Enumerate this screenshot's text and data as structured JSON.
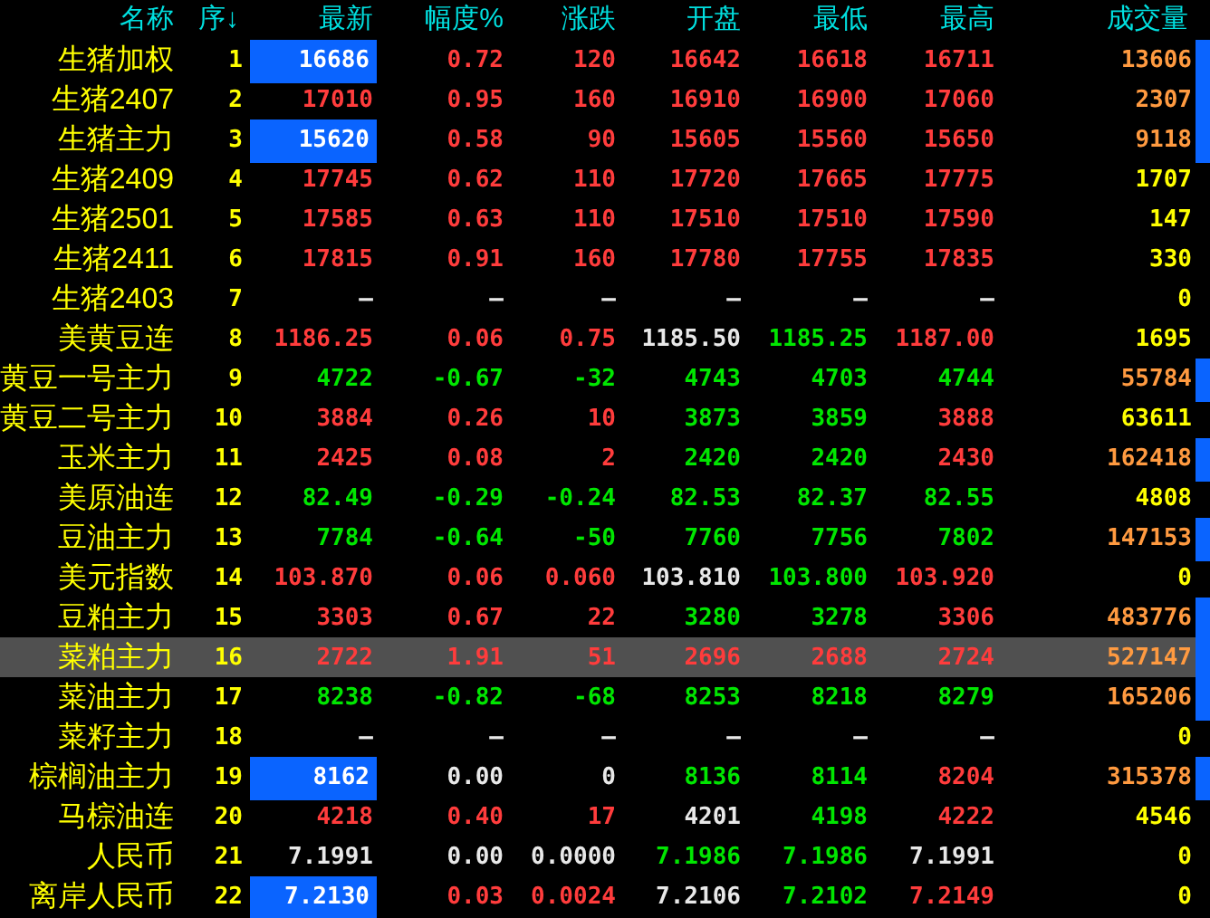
{
  "columns": [
    "名称",
    "序↓",
    "最新",
    "幅度%",
    "涨跌",
    "开盘",
    "最低",
    "最高",
    "成交量"
  ],
  "rows": [
    {
      "name": "生猪加权",
      "seq": "1",
      "selected": false,
      "latest_highlight": true,
      "volume_flag": true,
      "cells": [
        {
          "text": "16686"
        },
        {
          "text": "0.72",
          "kind": "up"
        },
        {
          "text": "120",
          "kind": "up"
        },
        {
          "text": "16642",
          "kind": "up"
        },
        {
          "text": "16618",
          "kind": "up"
        },
        {
          "text": "16711",
          "kind": "up"
        }
      ],
      "volume": {
        "text": "13606",
        "kind": "heavy"
      }
    },
    {
      "name": "生猪2407",
      "seq": "2",
      "selected": false,
      "latest_highlight": false,
      "volume_flag": true,
      "cells": [
        {
          "text": "17010",
          "kind": "up"
        },
        {
          "text": "0.95",
          "kind": "up"
        },
        {
          "text": "160",
          "kind": "up"
        },
        {
          "text": "16910",
          "kind": "up"
        },
        {
          "text": "16900",
          "kind": "up"
        },
        {
          "text": "17060",
          "kind": "up"
        }
      ],
      "volume": {
        "text": "2307",
        "kind": "heavy"
      }
    },
    {
      "name": "生猪主力",
      "seq": "3",
      "selected": false,
      "latest_highlight": true,
      "volume_flag": true,
      "cells": [
        {
          "text": "15620"
        },
        {
          "text": "0.58",
          "kind": "up"
        },
        {
          "text": "90",
          "kind": "up"
        },
        {
          "text": "15605",
          "kind": "up"
        },
        {
          "text": "15560",
          "kind": "up"
        },
        {
          "text": "15650",
          "kind": "up"
        }
      ],
      "volume": {
        "text": "9118",
        "kind": "heavy"
      }
    },
    {
      "name": "生猪2409",
      "seq": "4",
      "selected": false,
      "latest_highlight": false,
      "volume_flag": false,
      "cells": [
        {
          "text": "17745",
          "kind": "up"
        },
        {
          "text": "0.62",
          "kind": "up"
        },
        {
          "text": "110",
          "kind": "up"
        },
        {
          "text": "17720",
          "kind": "up"
        },
        {
          "text": "17665",
          "kind": "up"
        },
        {
          "text": "17775",
          "kind": "up"
        }
      ],
      "volume": {
        "text": "1707",
        "kind": "light"
      }
    },
    {
      "name": "生猪2501",
      "seq": "5",
      "selected": false,
      "latest_highlight": false,
      "volume_flag": false,
      "cells": [
        {
          "text": "17585",
          "kind": "up"
        },
        {
          "text": "0.63",
          "kind": "up"
        },
        {
          "text": "110",
          "kind": "up"
        },
        {
          "text": "17510",
          "kind": "up"
        },
        {
          "text": "17510",
          "kind": "up"
        },
        {
          "text": "17590",
          "kind": "up"
        }
      ],
      "volume": {
        "text": "147",
        "kind": "light"
      }
    },
    {
      "name": "生猪2411",
      "seq": "6",
      "selected": false,
      "latest_highlight": false,
      "volume_flag": false,
      "cells": [
        {
          "text": "17815",
          "kind": "up"
        },
        {
          "text": "0.91",
          "kind": "up"
        },
        {
          "text": "160",
          "kind": "up"
        },
        {
          "text": "17780",
          "kind": "up"
        },
        {
          "text": "17755",
          "kind": "up"
        },
        {
          "text": "17835",
          "kind": "up"
        }
      ],
      "volume": {
        "text": "330",
        "kind": "light"
      }
    },
    {
      "name": "生猪2403",
      "seq": "7",
      "selected": false,
      "latest_highlight": false,
      "volume_flag": false,
      "cells": [
        {
          "text": "—",
          "kind": "flat"
        },
        {
          "text": "—",
          "kind": "flat"
        },
        {
          "text": "—",
          "kind": "flat"
        },
        {
          "text": "—",
          "kind": "flat"
        },
        {
          "text": "—",
          "kind": "flat"
        },
        {
          "text": "—",
          "kind": "flat"
        }
      ],
      "volume": {
        "text": "0",
        "kind": "light"
      }
    },
    {
      "name": "美黄豆连",
      "seq": "8",
      "selected": false,
      "latest_highlight": false,
      "volume_flag": false,
      "cells": [
        {
          "text": "1186.25",
          "kind": "up"
        },
        {
          "text": "0.06",
          "kind": "up"
        },
        {
          "text": "0.75",
          "kind": "up"
        },
        {
          "text": "1185.50",
          "kind": "flat"
        },
        {
          "text": "1185.25",
          "kind": "down"
        },
        {
          "text": "1187.00",
          "kind": "up"
        }
      ],
      "volume": {
        "text": "1695",
        "kind": "light"
      }
    },
    {
      "name": "黄豆一号主力",
      "seq": "9",
      "selected": false,
      "latest_highlight": false,
      "volume_flag": true,
      "cells": [
        {
          "text": "4722",
          "kind": "down"
        },
        {
          "text": "-0.67",
          "kind": "down"
        },
        {
          "text": "-32",
          "kind": "down"
        },
        {
          "text": "4743",
          "kind": "down"
        },
        {
          "text": "4703",
          "kind": "down"
        },
        {
          "text": "4744",
          "kind": "down"
        }
      ],
      "volume": {
        "text": "55784",
        "kind": "heavy"
      }
    },
    {
      "name": "黄豆二号主力",
      "seq": "10",
      "selected": false,
      "latest_highlight": false,
      "volume_flag": false,
      "cells": [
        {
          "text": "3884",
          "kind": "up"
        },
        {
          "text": "0.26",
          "kind": "up"
        },
        {
          "text": "10",
          "kind": "up"
        },
        {
          "text": "3873",
          "kind": "down"
        },
        {
          "text": "3859",
          "kind": "down"
        },
        {
          "text": "3888",
          "kind": "up"
        }
      ],
      "volume": {
        "text": "63611",
        "kind": "light"
      }
    },
    {
      "name": "玉米主力",
      "seq": "11",
      "selected": false,
      "latest_highlight": false,
      "volume_flag": true,
      "cells": [
        {
          "text": "2425",
          "kind": "up"
        },
        {
          "text": "0.08",
          "kind": "up"
        },
        {
          "text": "2",
          "kind": "up"
        },
        {
          "text": "2420",
          "kind": "down"
        },
        {
          "text": "2420",
          "kind": "down"
        },
        {
          "text": "2430",
          "kind": "up"
        }
      ],
      "volume": {
        "text": "162418",
        "kind": "heavy"
      }
    },
    {
      "name": "美原油连",
      "seq": "12",
      "selected": false,
      "latest_highlight": false,
      "volume_flag": false,
      "cells": [
        {
          "text": "82.49",
          "kind": "down"
        },
        {
          "text": "-0.29",
          "kind": "down"
        },
        {
          "text": "-0.24",
          "kind": "down"
        },
        {
          "text": "82.53",
          "kind": "down"
        },
        {
          "text": "82.37",
          "kind": "down"
        },
        {
          "text": "82.55",
          "kind": "down"
        }
      ],
      "volume": {
        "text": "4808",
        "kind": "light"
      }
    },
    {
      "name": "豆油主力",
      "seq": "13",
      "selected": false,
      "latest_highlight": false,
      "volume_flag": true,
      "cells": [
        {
          "text": "7784",
          "kind": "down"
        },
        {
          "text": "-0.64",
          "kind": "down"
        },
        {
          "text": "-50",
          "kind": "down"
        },
        {
          "text": "7760",
          "kind": "down"
        },
        {
          "text": "7756",
          "kind": "down"
        },
        {
          "text": "7802",
          "kind": "down"
        }
      ],
      "volume": {
        "text": "147153",
        "kind": "heavy"
      }
    },
    {
      "name": "美元指数",
      "seq": "14",
      "selected": false,
      "latest_highlight": false,
      "volume_flag": false,
      "cells": [
        {
          "text": "103.870",
          "kind": "up"
        },
        {
          "text": "0.06",
          "kind": "up"
        },
        {
          "text": "0.060",
          "kind": "up"
        },
        {
          "text": "103.810",
          "kind": "flat"
        },
        {
          "text": "103.800",
          "kind": "down"
        },
        {
          "text": "103.920",
          "kind": "up"
        }
      ],
      "volume": {
        "text": "0",
        "kind": "light"
      }
    },
    {
      "name": "豆粕主力",
      "seq": "15",
      "selected": false,
      "latest_highlight": false,
      "volume_flag": true,
      "cells": [
        {
          "text": "3303",
          "kind": "up"
        },
        {
          "text": "0.67",
          "kind": "up"
        },
        {
          "text": "22",
          "kind": "up"
        },
        {
          "text": "3280",
          "kind": "down"
        },
        {
          "text": "3278",
          "kind": "down"
        },
        {
          "text": "3306",
          "kind": "up"
        }
      ],
      "volume": {
        "text": "483776",
        "kind": "heavy"
      }
    },
    {
      "name": "菜粕主力",
      "seq": "16",
      "selected": true,
      "latest_highlight": false,
      "volume_flag": true,
      "cells": [
        {
          "text": "2722",
          "kind": "up"
        },
        {
          "text": "1.91",
          "kind": "up"
        },
        {
          "text": "51",
          "kind": "up"
        },
        {
          "text": "2696",
          "kind": "up"
        },
        {
          "text": "2688",
          "kind": "up"
        },
        {
          "text": "2724",
          "kind": "up"
        }
      ],
      "volume": {
        "text": "527147",
        "kind": "heavy"
      }
    },
    {
      "name": "菜油主力",
      "seq": "17",
      "selected": false,
      "latest_highlight": false,
      "volume_flag": true,
      "cells": [
        {
          "text": "8238",
          "kind": "down"
        },
        {
          "text": "-0.82",
          "kind": "down"
        },
        {
          "text": "-68",
          "kind": "down"
        },
        {
          "text": "8253",
          "kind": "down"
        },
        {
          "text": "8218",
          "kind": "down"
        },
        {
          "text": "8279",
          "kind": "down"
        }
      ],
      "volume": {
        "text": "165206",
        "kind": "heavy"
      }
    },
    {
      "name": "菜籽主力",
      "seq": "18",
      "selected": false,
      "latest_highlight": false,
      "volume_flag": false,
      "cells": [
        {
          "text": "—",
          "kind": "flat"
        },
        {
          "text": "—",
          "kind": "flat"
        },
        {
          "text": "—",
          "kind": "flat"
        },
        {
          "text": "—",
          "kind": "flat"
        },
        {
          "text": "—",
          "kind": "flat"
        },
        {
          "text": "—",
          "kind": "flat"
        }
      ],
      "volume": {
        "text": "0",
        "kind": "light"
      }
    },
    {
      "name": "棕榈油主力",
      "seq": "19",
      "selected": false,
      "latest_highlight": true,
      "volume_flag": true,
      "cells": [
        {
          "text": "8162"
        },
        {
          "text": "0.00",
          "kind": "flat"
        },
        {
          "text": "0",
          "kind": "flat"
        },
        {
          "text": "8136",
          "kind": "down"
        },
        {
          "text": "8114",
          "kind": "down"
        },
        {
          "text": "8204",
          "kind": "up"
        }
      ],
      "volume": {
        "text": "315378",
        "kind": "heavy"
      }
    },
    {
      "name": "马棕油连",
      "seq": "20",
      "selected": false,
      "latest_highlight": false,
      "volume_flag": false,
      "cells": [
        {
          "text": "4218",
          "kind": "up"
        },
        {
          "text": "0.40",
          "kind": "up"
        },
        {
          "text": "17",
          "kind": "up"
        },
        {
          "text": "4201",
          "kind": "flat"
        },
        {
          "text": "4198",
          "kind": "down"
        },
        {
          "text": "4222",
          "kind": "up"
        }
      ],
      "volume": {
        "text": "4546",
        "kind": "light"
      }
    },
    {
      "name": "人民币",
      "seq": "21",
      "selected": false,
      "latest_highlight": false,
      "volume_flag": false,
      "cells": [
        {
          "text": "7.1991",
          "kind": "flat"
        },
        {
          "text": "0.00",
          "kind": "flat"
        },
        {
          "text": "0.0000",
          "kind": "flat"
        },
        {
          "text": "7.1986",
          "kind": "down"
        },
        {
          "text": "7.1986",
          "kind": "down"
        },
        {
          "text": "7.1991",
          "kind": "flat"
        }
      ],
      "volume": {
        "text": "0",
        "kind": "light"
      }
    },
    {
      "name": "离岸人民币",
      "seq": "22",
      "selected": false,
      "latest_highlight": true,
      "volume_flag": false,
      "cells": [
        {
          "text": "7.2130"
        },
        {
          "text": "0.03",
          "kind": "up"
        },
        {
          "text": "0.0024",
          "kind": "up"
        },
        {
          "text": "7.2106",
          "kind": "flat"
        },
        {
          "text": "7.2102",
          "kind": "down"
        },
        {
          "text": "7.2149",
          "kind": "up"
        }
      ],
      "volume": {
        "text": "0",
        "kind": "light"
      }
    }
  ]
}
